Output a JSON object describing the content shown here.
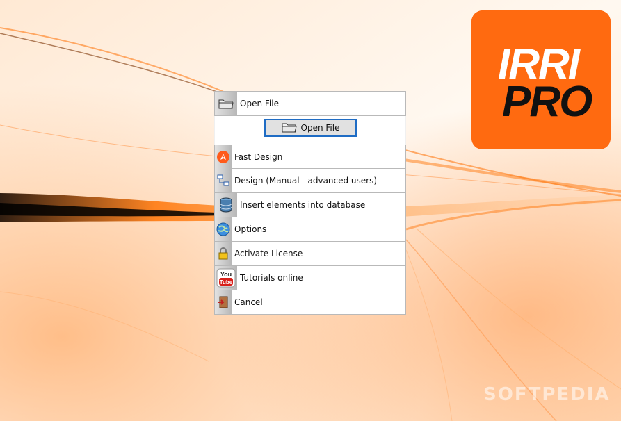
{
  "logo": {
    "line1": "IRRI",
    "line2": "PRO",
    "color": "#ff6a10"
  },
  "watermark": "SOFTPEDIA",
  "menu": {
    "items": [
      {
        "label": "Open File",
        "icon": "folder-icon"
      },
      {
        "label": "Fast Design",
        "icon": "rocket-icon"
      },
      {
        "label": "Design (Manual - advanced users)",
        "icon": "design-diagram-icon"
      },
      {
        "label": "Insert elements into database",
        "icon": "database-icon"
      },
      {
        "label": "Options",
        "icon": "globe-icon"
      },
      {
        "label": "Activate License",
        "icon": "padlock-icon"
      },
      {
        "label": "Tutorials online",
        "icon": "youtube-icon"
      },
      {
        "label": "Cancel",
        "icon": "exit-door-icon"
      }
    ],
    "open_button": {
      "label": "Open File",
      "icon": "folder-icon"
    }
  }
}
